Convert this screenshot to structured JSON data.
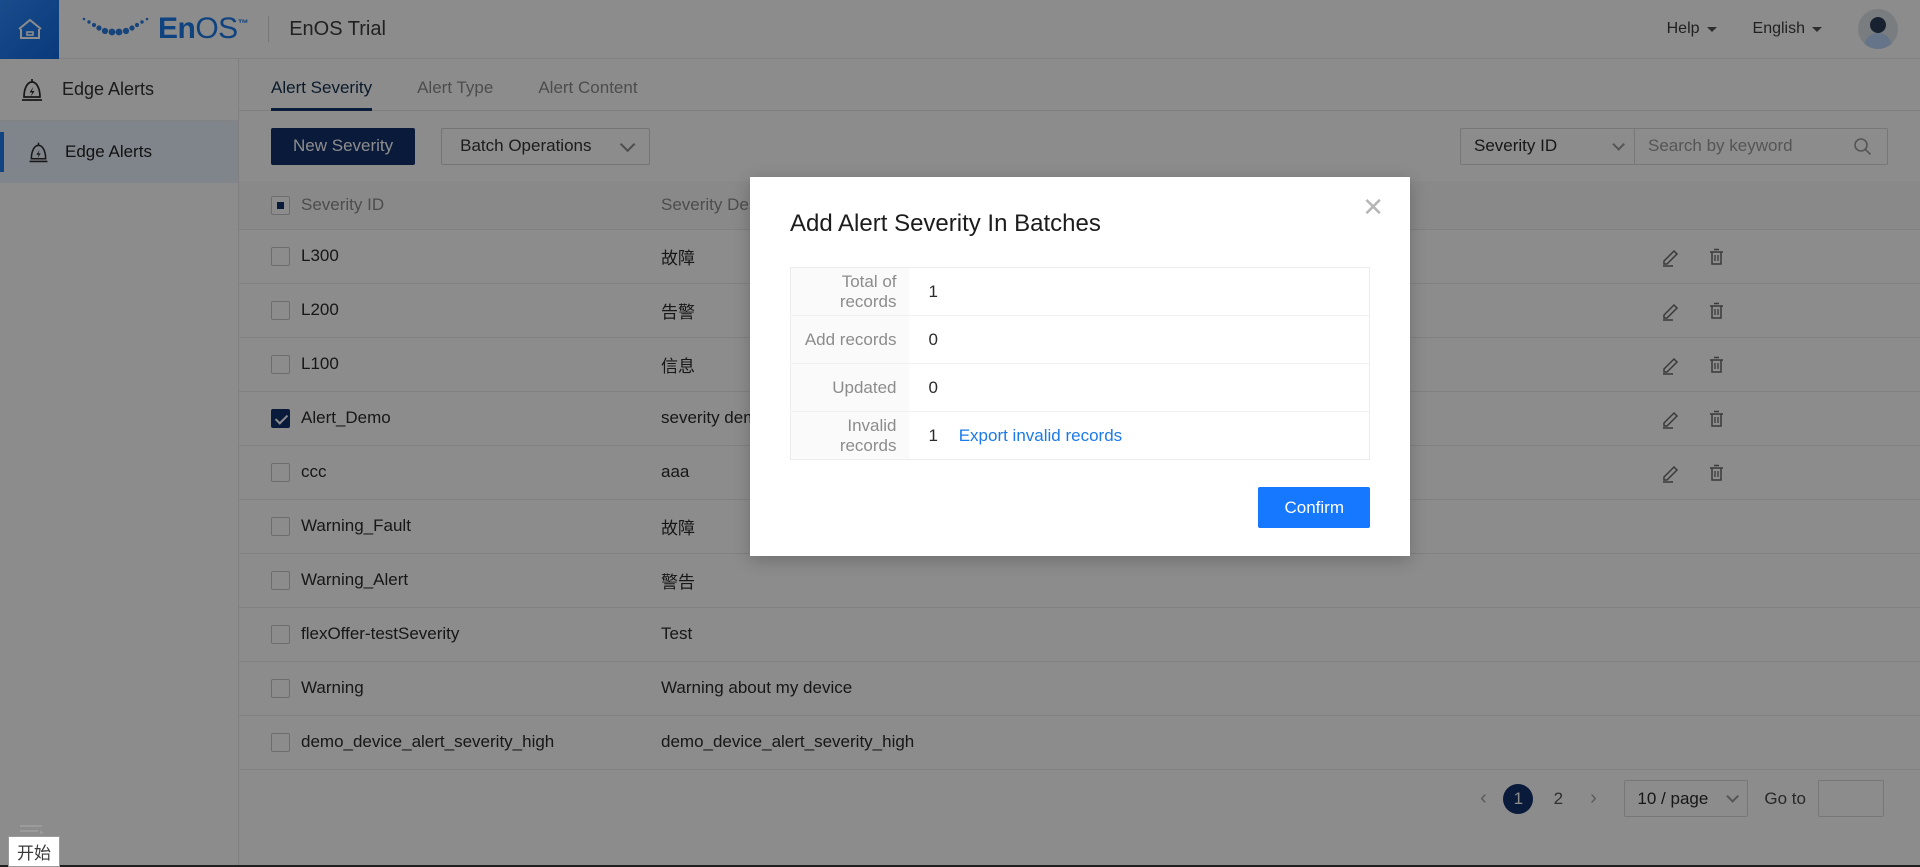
{
  "header": {
    "home_icon": "home-icon",
    "logo_text_en": "En",
    "logo_text_os": "OS",
    "logo_tm": "™",
    "app_title": "EnOS Trial",
    "help_label": "Help",
    "language_label": "English",
    "avatar": "user-avatar"
  },
  "sidebar": {
    "group_label": "Edge Alerts",
    "items": [
      {
        "label": "Edge Alerts",
        "active": true
      }
    ]
  },
  "tabs": [
    {
      "label": "Alert Severity",
      "active": true
    },
    {
      "label": "Alert Type",
      "active": false
    },
    {
      "label": "Alert Content",
      "active": false
    }
  ],
  "toolbar": {
    "new_severity_label": "New Severity",
    "batch_operations_label": "Batch Operations",
    "filter_selected": "Severity ID",
    "search_placeholder": "Search by keyword",
    "search_value": ""
  },
  "table": {
    "columns": [
      "",
      "Severity ID",
      "Severity Description",
      ""
    ],
    "header_checkbox_state": "indeterminate",
    "rows": [
      {
        "checked": false,
        "id": "L300",
        "desc": "故障",
        "actions": true
      },
      {
        "checked": false,
        "id": "L200",
        "desc": "告警",
        "actions": true
      },
      {
        "checked": false,
        "id": "L100",
        "desc": "信息",
        "actions": true
      },
      {
        "checked": true,
        "id": "Alert_Demo",
        "desc": "severity demo",
        "actions": true
      },
      {
        "checked": false,
        "id": "ccc",
        "desc": "aaa",
        "actions": true
      },
      {
        "checked": false,
        "id": "Warning_Fault",
        "desc": "故障",
        "actions": true
      },
      {
        "checked": false,
        "id": "Warning_Alert",
        "desc": "警告",
        "actions": true
      },
      {
        "checked": false,
        "id": "flexOffer-testSeverity",
        "desc": "Test",
        "actions": true
      },
      {
        "checked": false,
        "id": "Warning",
        "desc": "Warning about my device",
        "actions": true
      },
      {
        "checked": false,
        "id": "demo_device_alert_severity_high",
        "desc": "demo_device_alert_severity_high",
        "actions": true
      }
    ]
  },
  "pagination": {
    "prev": "‹",
    "next": "›",
    "pages": [
      "1",
      "2"
    ],
    "current_page": "1",
    "page_size_label": "10 / page",
    "goto_label": "Go to",
    "goto_value": ""
  },
  "modal": {
    "title": "Add Alert Severity In Batches",
    "close_icon": "close-icon",
    "rows": [
      {
        "label": "Total of records",
        "value": "1",
        "link": ""
      },
      {
        "label": "Add records",
        "value": "0",
        "link": ""
      },
      {
        "label": "Updated",
        "value": "0",
        "link": ""
      },
      {
        "label": "Invalid records",
        "value": "1",
        "link": "Export invalid records"
      }
    ],
    "confirm_label": "Confirm"
  },
  "taskbar": {
    "start_label": "开始"
  },
  "colors": {
    "brand_blue": "#1b7ae8",
    "primary_dark": "#12306b",
    "confirm_blue": "#1677ff",
    "link_blue": "#1b7ae8",
    "overlay": "rgba(0,0,0,0.45)"
  }
}
